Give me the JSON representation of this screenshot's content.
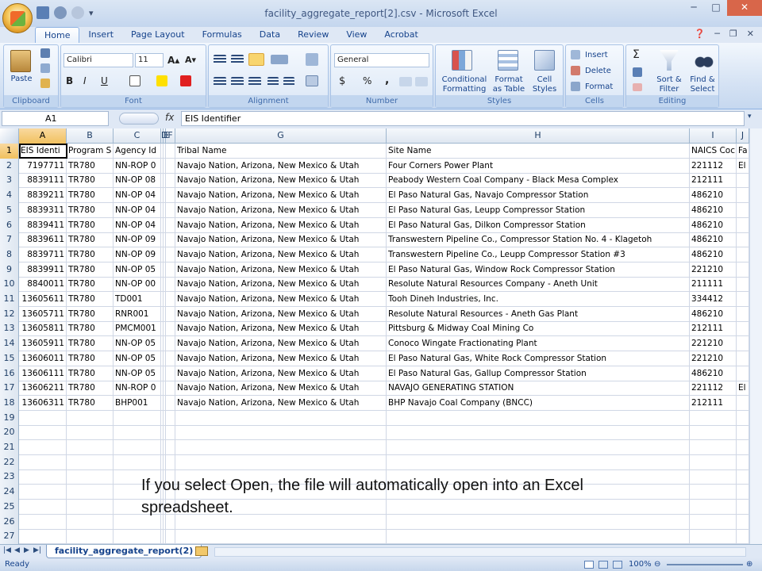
{
  "window": {
    "title": "facility_aggregate_report[2].csv - Microsoft Excel"
  },
  "tabs": [
    "Home",
    "Insert",
    "Page Layout",
    "Formulas",
    "Data",
    "Review",
    "View",
    "Acrobat"
  ],
  "ribbon": {
    "clipboard": {
      "label": "Clipboard",
      "paste": "Paste"
    },
    "font": {
      "label": "Font",
      "family": "Calibri",
      "size": "11",
      "bold": "B",
      "italic": "I",
      "underline": "U"
    },
    "alignment": {
      "label": "Alignment"
    },
    "number": {
      "label": "Number",
      "format": "General",
      "currency": "$",
      "percent": "%",
      "comma": ","
    },
    "styles": {
      "label": "Styles",
      "conditional": "Conditional Formatting",
      "format_table": "Format as Table",
      "cell_styles": "Cell Styles"
    },
    "cells": {
      "label": "Cells",
      "insert": "Insert",
      "delete": "Delete",
      "format": "Format"
    },
    "editing": {
      "label": "Editing",
      "sort": "Sort & Filter",
      "find": "Find & Select"
    }
  },
  "formula_bar": {
    "name_box": "A1",
    "fx": "fx",
    "content": "EIS Identifier"
  },
  "columns": [
    {
      "letter": "A",
      "selected": true
    },
    {
      "letter": "B"
    },
    {
      "letter": "C"
    },
    {
      "letter": "D"
    },
    {
      "letter": "E"
    },
    {
      "letter": "F"
    },
    {
      "letter": "G"
    },
    {
      "letter": "H"
    },
    {
      "letter": "I"
    },
    {
      "letter": "J"
    },
    {
      "letter": ""
    }
  ],
  "header_row": [
    "EIS Identi",
    "Program S",
    "Agency Id",
    "",
    "",
    "IS",
    "Tribal Name",
    "Site Name",
    "NAICS Coc",
    "Fa"
  ],
  "rows": [
    [
      "7197711",
      "TR780",
      "NN-ROP 0",
      "Navajo Nation, Arizona, New Mexico & Utah",
      "Four Corners Power Plant",
      "221112",
      "El"
    ],
    [
      "8839111",
      "TR780",
      "NN-OP 08",
      "Navajo Nation, Arizona, New Mexico & Utah",
      "Peabody Western Coal Company - Black Mesa Complex",
      "212111",
      ""
    ],
    [
      "8839211",
      "TR780",
      "NN-OP 04",
      "Navajo Nation, Arizona, New Mexico & Utah",
      "El Paso Natural Gas, Navajo Compressor Station",
      "486210",
      ""
    ],
    [
      "8839311",
      "TR780",
      "NN-OP 04",
      "Navajo Nation, Arizona, New Mexico & Utah",
      "El Paso Natural Gas, Leupp Compressor Station",
      "486210",
      ""
    ],
    [
      "8839411",
      "TR780",
      "NN-OP 04",
      "Navajo Nation, Arizona, New Mexico & Utah",
      "El Paso Natural Gas, Dilkon Compressor Station",
      "486210",
      ""
    ],
    [
      "8839611",
      "TR780",
      "NN-OP 09",
      "Navajo Nation, Arizona, New Mexico & Utah",
      "Transwestern Pipeline Co., Compressor Station No. 4 - Klagetoh",
      "486210",
      ""
    ],
    [
      "8839711",
      "TR780",
      "NN-OP 09",
      "Navajo Nation, Arizona, New Mexico & Utah",
      "Transwestern Pipeline Co., Leupp Compressor Station #3",
      "486210",
      ""
    ],
    [
      "8839911",
      "TR780",
      "NN-OP 05",
      "Navajo Nation, Arizona, New Mexico & Utah",
      "El Paso Natural Gas, Window Rock Compressor Station",
      "221210",
      ""
    ],
    [
      "8840011",
      "TR780",
      "NN-OP 00",
      "Navajo Nation, Arizona, New Mexico & Utah",
      "Resolute Natural Resources Company - Aneth Unit",
      "211111",
      ""
    ],
    [
      "13605611",
      "TR780",
      "TD001",
      "Navajo Nation, Arizona, New Mexico & Utah",
      "Tooh Dineh Industries, Inc.",
      "334412",
      ""
    ],
    [
      "13605711",
      "TR780",
      "RNR001",
      "Navajo Nation, Arizona, New Mexico & Utah",
      "Resolute Natural Resources - Aneth Gas Plant",
      "486210",
      ""
    ],
    [
      "13605811",
      "TR780",
      "PMCM001",
      "Navajo Nation, Arizona, New Mexico & Utah",
      "Pittsburg & Midway Coal Mining Co",
      "212111",
      ""
    ],
    [
      "13605911",
      "TR780",
      "NN-OP 05",
      "Navajo Nation, Arizona, New Mexico & Utah",
      "Conoco Wingate Fractionating Plant",
      "221210",
      ""
    ],
    [
      "13606011",
      "TR780",
      "NN-OP 05",
      "Navajo Nation, Arizona, New Mexico & Utah",
      "El Paso Natural Gas, White Rock Compressor Station",
      "221210",
      ""
    ],
    [
      "13606111",
      "TR780",
      "NN-OP 05",
      "Navajo Nation, Arizona, New Mexico & Utah",
      "El Paso Natural Gas, Gallup Compressor Station",
      "486210",
      ""
    ],
    [
      "13606211",
      "TR780",
      "NN-ROP 0",
      "Navajo Nation, Arizona, New Mexico & Utah",
      "NAVAJO GENERATING STATION",
      "221112",
      "El"
    ],
    [
      "13606311",
      "TR780",
      "BHP001",
      "Navajo Nation, Arizona, New Mexico & Utah",
      "BHP Navajo Coal Company (BNCC)",
      "212111",
      ""
    ]
  ],
  "row_numbers": [
    "1",
    "2",
    "3",
    "4",
    "5",
    "6",
    "7",
    "8",
    "9",
    "10",
    "11",
    "12",
    "13",
    "14",
    "15",
    "16",
    "17",
    "18",
    "19",
    "20",
    "21",
    "22",
    "23",
    "24",
    "25",
    "26",
    "27"
  ],
  "note": "If you select Open, the file will automatically open into an Excel spreadsheet.",
  "sheet_tab": "facility_aggregate_report(2)",
  "status": {
    "ready": "Ready",
    "zoom": "100%"
  }
}
